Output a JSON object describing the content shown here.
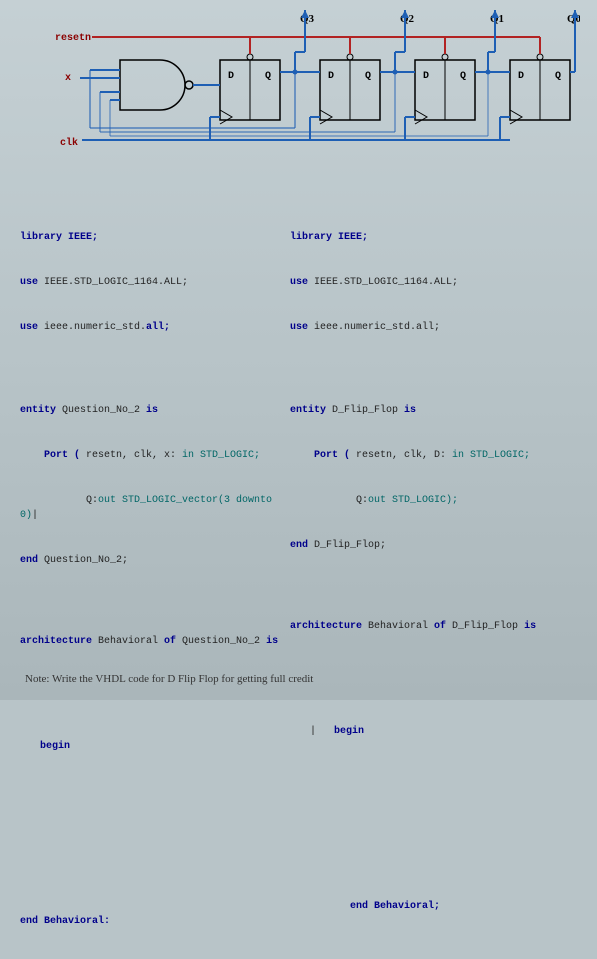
{
  "diagram": {
    "labels": {
      "resetn": "resetn",
      "x": "x",
      "clk": "clk",
      "Q3": "Q3",
      "Q2": "Q2",
      "Q1": "Q1",
      "Q0": "Q0",
      "D": "D",
      "Q": "Q"
    }
  },
  "code_left": {
    "l1": "library IEEE;",
    "l2a": "use ",
    "l2b": "IEEE.STD_LOGIC_1164.ALL",
    "l2c": ";",
    "l3a": "use ",
    "l3b": "ieee.numeric_std.",
    "l3c": "all;",
    "l4a": "entity ",
    "l4b": "Question_No_2 ",
    "l4c": "is",
    "l5a": "    Port ( ",
    "l5b": "resetn, clk, x: ",
    "l5c": "in STD_LOGIC;",
    "l6a": "           Q:",
    "l6b": "out STD_LOGIC_vector(3 downto 0)",
    "l6c": "|",
    "l7a": "end ",
    "l7b": "Question_No_2;",
    "l8a": "architecture ",
    "l8b": "Behavioral ",
    "l8c": "of ",
    "l8d": "Question_No_2 ",
    "l8e": "is",
    "l9a": "begin",
    "l10": "end Behavioral:"
  },
  "code_right": {
    "l1": "library IEEE;",
    "l2a": "use ",
    "l2b": "IEEE.STD_LOGIC_1164.ALL",
    "l2c": ";",
    "l3a": "use ",
    "l3b": "ieee.numeric_std.all;",
    "l4a": "entity ",
    "l4b": "D_Flip_Flop ",
    "l4c": "is",
    "l5a": "    Port ( ",
    "l5b": "resetn, clk, D: ",
    "l5c": "in STD_LOGIC;",
    "l6a": "           Q:",
    "l6b": "out STD_LOGIC);",
    "l7a": "end ",
    "l7b": "D_Flip_Flop;",
    "l8a": "architecture ",
    "l8b": "Behavioral ",
    "l8c": "of ",
    "l8d": "D_Flip_Flop ",
    "l8e": "is",
    "l9_pipe": "|",
    "l9a": "begin",
    "l10": "end Behavioral;"
  },
  "note": "Note: Write the VHDL code for D Flip Flop for getting full credit"
}
